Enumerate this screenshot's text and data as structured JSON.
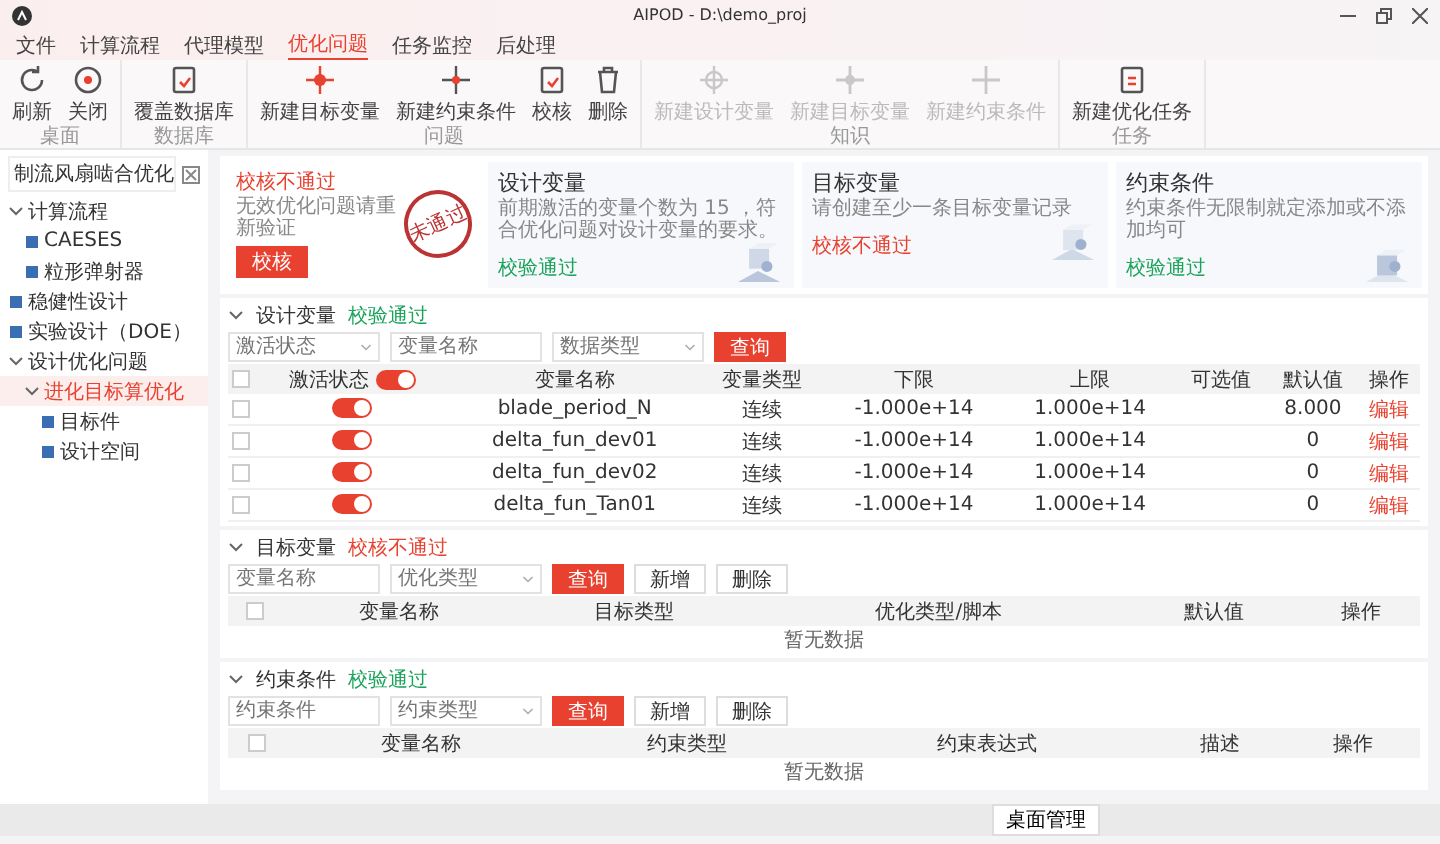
{
  "window": {
    "title": "AIPOD - D:\\demo_proj"
  },
  "menu": [
    {
      "label": "文件",
      "selected": false
    },
    {
      "label": "计算流程",
      "selected": false
    },
    {
      "label": "代理模型",
      "selected": false
    },
    {
      "label": "优化问题",
      "selected": true
    },
    {
      "label": "任务监控",
      "selected": false
    },
    {
      "label": "后处理",
      "selected": false
    }
  ],
  "ribbon": [
    {
      "group": "桌面",
      "items": [
        {
          "label": "刷新",
          "disabled": false
        },
        {
          "label": "关闭",
          "disabled": false
        }
      ]
    },
    {
      "group": "数据库",
      "items": [
        {
          "label": "覆盖数据库",
          "disabled": false
        }
      ]
    },
    {
      "group": "问题",
      "items": [
        {
          "label": "新建目标变量",
          "disabled": false
        },
        {
          "label": "新建约束条件",
          "disabled": false
        },
        {
          "label": "校核",
          "disabled": false
        },
        {
          "label": "删除",
          "disabled": false
        }
      ]
    },
    {
      "group": "知识",
      "items": [
        {
          "label": "新建设计变量",
          "disabled": true
        },
        {
          "label": "新建目标变量",
          "disabled": true
        },
        {
          "label": "新建约束条件",
          "disabled": true
        }
      ]
    },
    {
      "group": "任务",
      "items": [
        {
          "label": "新建优化任务",
          "disabled": false
        }
      ]
    }
  ],
  "sidebar": {
    "project": "制流风扇啮合优化",
    "tree": [
      {
        "label": "计算流程",
        "selected": false,
        "expanded": true,
        "children": [
          {
            "label": "CAESES",
            "selected": false
          },
          {
            "label": "粒形弹射器",
            "selected": false
          }
        ]
      },
      {
        "label": "稳健性设计",
        "selected": false
      },
      {
        "label": "实验设计（DOE）",
        "selected": false
      },
      {
        "label": "设计优化问题",
        "selected": false,
        "expanded": true,
        "children": [
          {
            "label": "进化目标算优化",
            "selected": true,
            "expanded": true,
            "children": [
              {
                "label": "目标件",
                "selected": false
              },
              {
                "label": "设计空间",
                "selected": false
              }
            ]
          }
        ]
      }
    ]
  },
  "summary": {
    "status": "校核不通过",
    "message": "无效优化问题请重新验证",
    "button": "校核",
    "stamp": "未通过"
  },
  "cards": [
    {
      "title": "设计变量",
      "description": "前期激活的变量个数为 15 ，符合优化问题对设计变量的要求。",
      "status": "校验通过",
      "passed": true
    },
    {
      "title": "目标变量",
      "description": "请创建至少一条目标变量记录",
      "status": "校核不通过",
      "passed": false
    },
    {
      "title": "约束条件",
      "description": "约束条件无限制就定添加或不添加均可",
      "status": "校验通过",
      "passed": true
    }
  ],
  "sections": [
    {
      "title": "设计变量",
      "status": "校验通过",
      "passed": true,
      "expanded": true,
      "filters": [
        {
          "kind": "select",
          "placeholder": "激活状态"
        },
        {
          "kind": "input",
          "placeholder": "变量名称"
        },
        {
          "kind": "select",
          "placeholder": "数据类型"
        }
      ],
      "buttons": [
        {
          "label": "查询",
          "primary": true
        }
      ],
      "columns": [
        "激活状态",
        "变量名称",
        "变量类型",
        "下限",
        "上限",
        "可选值",
        "默认值",
        "操作"
      ],
      "all_checked": false,
      "all_active": true,
      "rows": [
        {
          "checked": false,
          "active": true,
          "name": "blade_period_N",
          "type": "连续",
          "lower": "-1.000e+14",
          "upper": "1.000e+14",
          "default": "8.000",
          "action": "编辑"
        },
        {
          "checked": false,
          "active": true,
          "name": "delta_fun_dev01",
          "type": "连续",
          "lower": "-1.000e+14",
          "upper": "1.000e+14",
          "default": "0",
          "action": "编辑"
        },
        {
          "checked": false,
          "active": true,
          "name": "delta_fun_dev02",
          "type": "连续",
          "lower": "-1.000e+14",
          "upper": "1.000e+14",
          "default": "0",
          "action": "编辑"
        },
        {
          "checked": false,
          "active": true,
          "name": "delta_fun_Tan01",
          "type": "连续",
          "lower": "-1.000e+14",
          "upper": "1.000e+14",
          "default": "0",
          "action": "编辑"
        }
      ]
    },
    {
      "title": "目标变量",
      "status": "校核不通过",
      "passed": false,
      "expanded": true,
      "filters": [
        {
          "kind": "input",
          "placeholder": "变量名称"
        },
        {
          "kind": "select",
          "placeholder": "优化类型"
        }
      ],
      "buttons": [
        {
          "label": "查询",
          "primary": true
        },
        {
          "label": "新增",
          "primary": false
        },
        {
          "label": "删除",
          "primary": false
        }
      ],
      "all_checked": false,
      "columns": [
        "变量名称",
        "目标类型",
        "优化类型/脚本",
        "默认值",
        "操作"
      ],
      "empty": "暂无数据"
    },
    {
      "title": "约束条件",
      "status": "校验通过",
      "passed": true,
      "expanded": true,
      "filters": [
        {
          "kind": "input",
          "placeholder": "约束条件"
        },
        {
          "kind": "select",
          "placeholder": "约束类型"
        }
      ],
      "buttons": [
        {
          "label": "查询",
          "primary": true
        },
        {
          "label": "新增",
          "primary": false
        },
        {
          "label": "删除",
          "primary": false
        }
      ],
      "all_checked": false,
      "columns": [
        "变量名称",
        "约束类型",
        "约束表达式",
        "描述",
        "操作"
      ],
      "empty": "暂无数据"
    }
  ],
  "status_bar": {
    "buttons": [
      "桌面管理"
    ]
  }
}
